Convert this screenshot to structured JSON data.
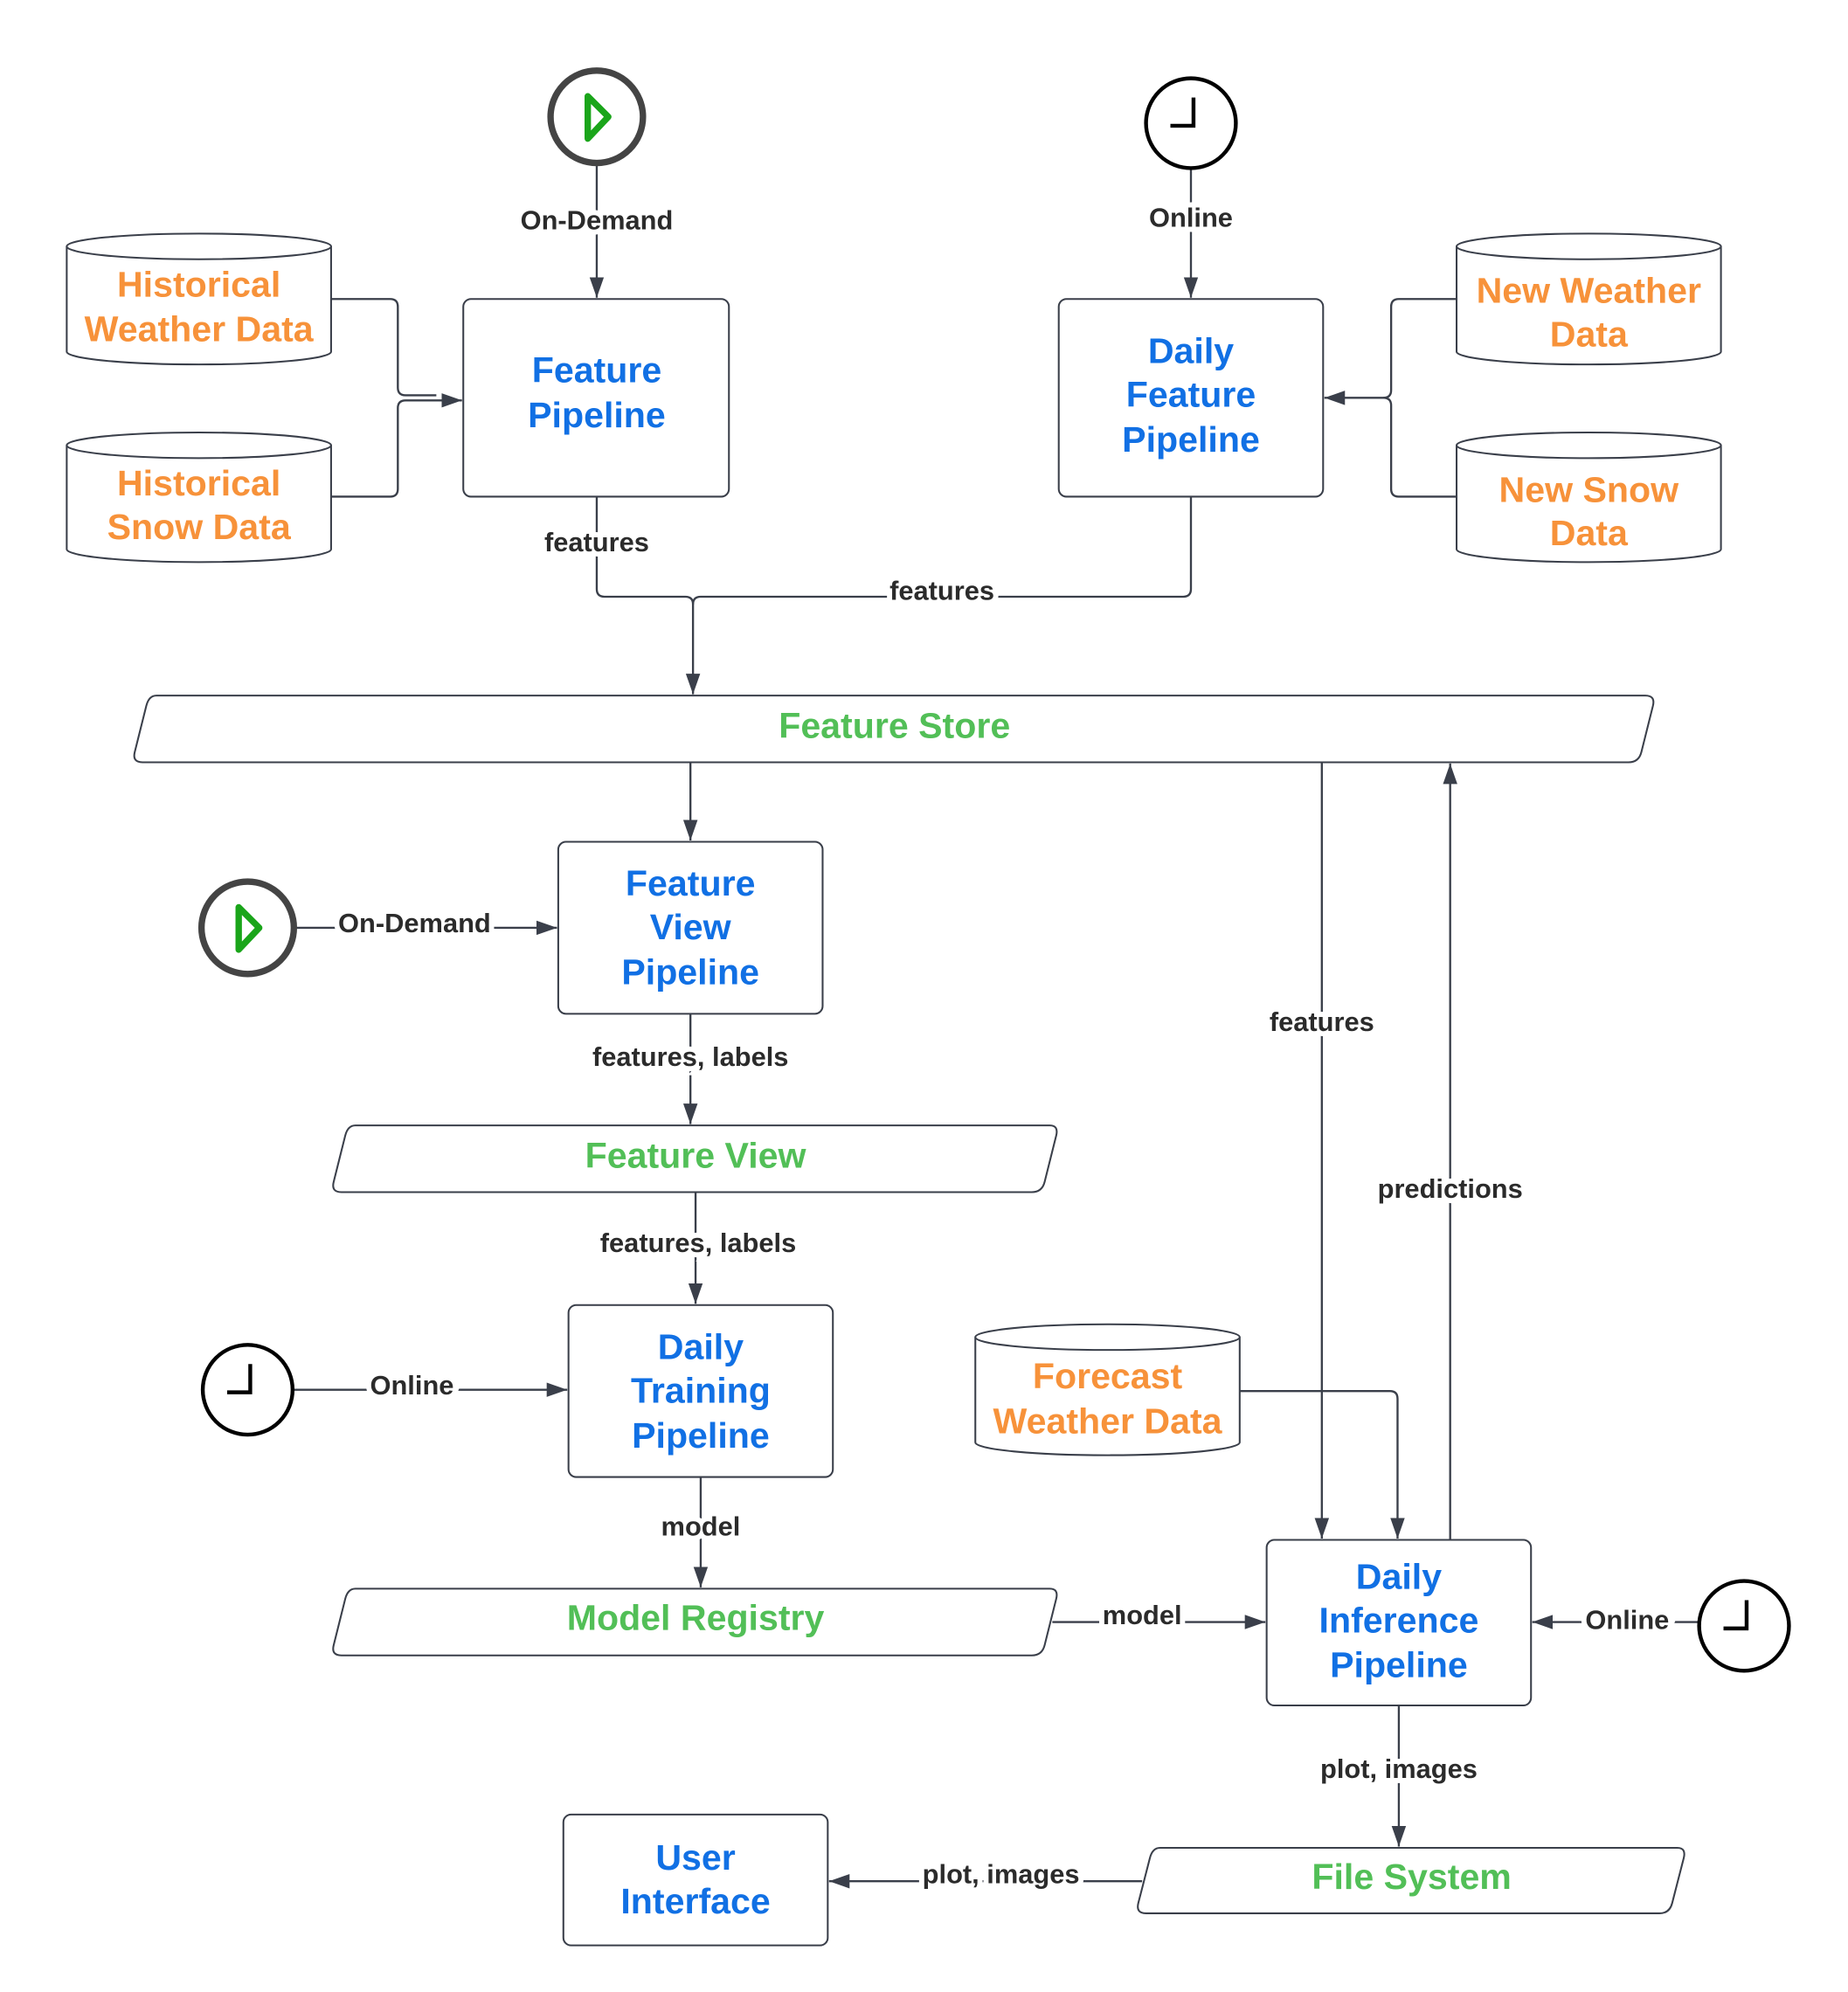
{
  "colors": {
    "pipeline": "#1170e4",
    "data_source": "#f7923a",
    "store": "#52bf57",
    "line": "#3a3f4a",
    "trigger_play": "#1aa51a"
  },
  "triggers": {
    "on_demand": "On-Demand",
    "online": "Online"
  },
  "icons": {
    "on_demand": "play-circle-icon",
    "online": "clock-icon"
  },
  "sources": {
    "historical_weather": [
      "Historical",
      "Weather Data"
    ],
    "historical_snow": [
      "Historical",
      "Snow Data"
    ],
    "new_weather": [
      "New Weather",
      "Data"
    ],
    "new_snow": [
      "New Snow",
      "Data"
    ],
    "forecast_weather": [
      "Forecast",
      "Weather Data"
    ]
  },
  "pipelines": {
    "feature": [
      "Feature",
      "Pipeline"
    ],
    "daily_feature": [
      "Daily",
      "Feature",
      "Pipeline"
    ],
    "feature_view": [
      "Feature",
      "View",
      "Pipeline"
    ],
    "daily_training": [
      "Daily",
      "Training",
      "Pipeline"
    ],
    "daily_inference": [
      "Daily",
      "Inference",
      "Pipeline"
    ],
    "user_interface": [
      "User",
      "Interface"
    ]
  },
  "stores": {
    "feature_store": "Feature Store",
    "feature_view": "Feature View",
    "model_registry": "Model Registry",
    "file_system": "File System"
  },
  "edges": {
    "features": "features",
    "features_labels": "features, labels",
    "model": "model",
    "predictions": "predictions",
    "plot_images": "plot, images"
  }
}
